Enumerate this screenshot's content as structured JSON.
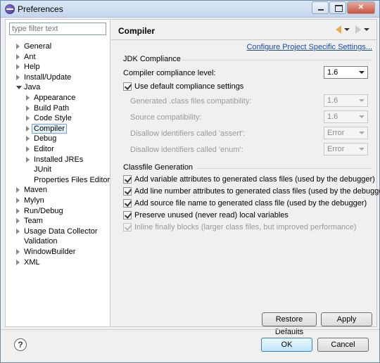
{
  "window": {
    "title": "Preferences",
    "close_glyph": "✕"
  },
  "filter": {
    "placeholder": "type filter text"
  },
  "tree": [
    {
      "label": "General",
      "level": 0,
      "arrow": "closed"
    },
    {
      "label": "Ant",
      "level": 0,
      "arrow": "closed"
    },
    {
      "label": "Help",
      "level": 0,
      "arrow": "closed"
    },
    {
      "label": "Install/Update",
      "level": 0,
      "arrow": "closed"
    },
    {
      "label": "Java",
      "level": 0,
      "arrow": "open"
    },
    {
      "label": "Appearance",
      "level": 1,
      "arrow": "closed"
    },
    {
      "label": "Build Path",
      "level": 1,
      "arrow": "closed"
    },
    {
      "label": "Code Style",
      "level": 1,
      "arrow": "closed"
    },
    {
      "label": "Compiler",
      "level": 1,
      "arrow": "closed",
      "selected": true
    },
    {
      "label": "Debug",
      "level": 1,
      "arrow": "closed"
    },
    {
      "label": "Editor",
      "level": 1,
      "arrow": "closed"
    },
    {
      "label": "Installed JREs",
      "level": 1,
      "arrow": "closed"
    },
    {
      "label": "JUnit",
      "level": 1,
      "arrow": "none"
    },
    {
      "label": "Properties Files Editor",
      "level": 1,
      "arrow": "none"
    },
    {
      "label": "Maven",
      "level": 0,
      "arrow": "closed"
    },
    {
      "label": "Mylyn",
      "level": 0,
      "arrow": "closed"
    },
    {
      "label": "Run/Debug",
      "level": 0,
      "arrow": "closed"
    },
    {
      "label": "Team",
      "level": 0,
      "arrow": "closed"
    },
    {
      "label": "Usage Data Collector",
      "level": 0,
      "arrow": "closed"
    },
    {
      "label": "Validation",
      "level": 0,
      "arrow": "none"
    },
    {
      "label": "WindowBuilder",
      "level": 0,
      "arrow": "closed"
    },
    {
      "label": "XML",
      "level": 0,
      "arrow": "closed"
    }
  ],
  "page": {
    "title": "Compiler",
    "config_link": "Configure Project Specific Settings..."
  },
  "jdk": {
    "group_label": "JDK Compliance",
    "compliance_label": "Compiler compliance level:",
    "compliance_value": "1.6",
    "use_default_label": "Use default compliance settings",
    "use_default_checked": true,
    "generated_label": "Generated .class files compatibility:",
    "generated_value": "1.6",
    "source_label": "Source compatibility:",
    "source_value": "1.6",
    "assert_label": "Disallow identifiers called 'assert':",
    "assert_value": "Error",
    "enum_label": "Disallow identifiers called 'enum':",
    "enum_value": "Error"
  },
  "classfile": {
    "group_label": "Classfile Generation",
    "options": [
      {
        "label": "Add variable attributes to generated class files (used by the debugger)",
        "checked": true,
        "disabled": false
      },
      {
        "label": "Add line number attributes to generated class files (used by the debugger)",
        "checked": true,
        "disabled": false
      },
      {
        "label": "Add source file name to generated class file (used by the debugger)",
        "checked": true,
        "disabled": false
      },
      {
        "label": "Preserve unused (never read) local variables",
        "checked": true,
        "disabled": false
      },
      {
        "label": "Inline finally blocks (larger class files, but improved performance)",
        "checked": true,
        "disabled": true
      }
    ]
  },
  "buttons": {
    "restore_defaults": "Restore Defaults",
    "apply": "Apply",
    "ok": "OK",
    "cancel": "Cancel",
    "help": "?"
  }
}
